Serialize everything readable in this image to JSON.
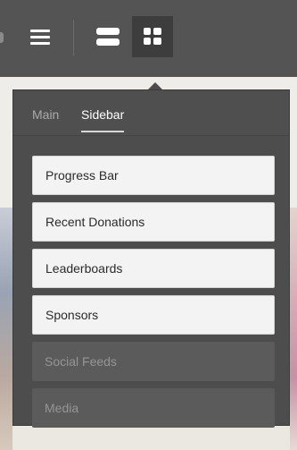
{
  "toolbar": {
    "buttons": [
      {
        "icon": "hamburger-menu-icon",
        "active": false
      },
      {
        "icon": "rows-layout-icon",
        "active": false
      },
      {
        "icon": "grid-layout-icon",
        "active": true
      }
    ]
  },
  "popover": {
    "tabs": [
      {
        "label": "Main",
        "active": false
      },
      {
        "label": "Sidebar",
        "active": true
      }
    ],
    "items": [
      {
        "label": "Progress Bar",
        "enabled": true
      },
      {
        "label": "Recent Donations",
        "enabled": true
      },
      {
        "label": "Leaderboards",
        "enabled": true
      },
      {
        "label": "Sponsors",
        "enabled": true
      },
      {
        "label": "Social Feeds",
        "enabled": false
      },
      {
        "label": "Media",
        "enabled": false
      }
    ]
  },
  "colors": {
    "toolbar_bg": "#545454",
    "popover_bg": "#4d4d4d",
    "enabled_item_bg": "#f3f3f3",
    "disabled_item_bg": "#5b5b5b"
  }
}
